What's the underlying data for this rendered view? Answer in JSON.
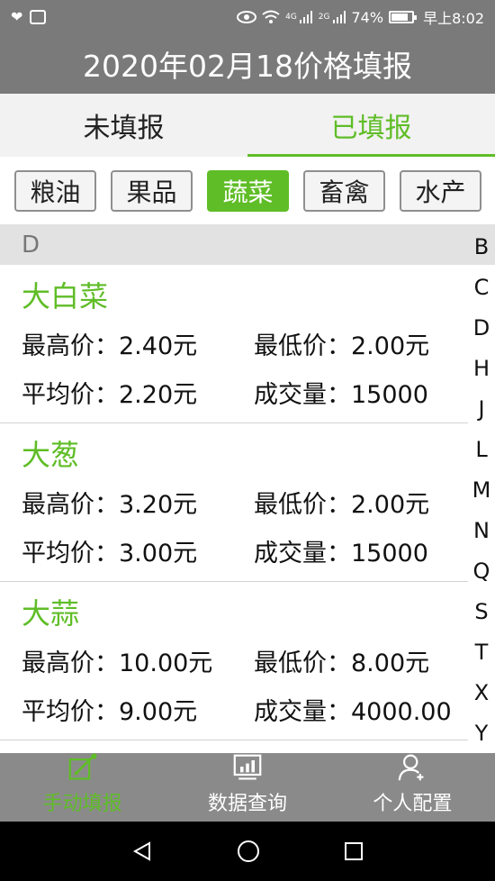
{
  "status_bar": {
    "battery_percent": "74%",
    "time": "早上8:02",
    "signal1": "4G",
    "signal2": "2G",
    "battery_level": 0.74,
    "icons": [
      "heart-monitor-icon",
      "app-icon",
      "eye-icon",
      "wifi-icon",
      "signal-icon",
      "signal-icon",
      "battery-icon"
    ]
  },
  "header": {
    "title": "2020年02月18价格填报"
  },
  "tabs": [
    {
      "label": "未填报",
      "active": false
    },
    {
      "label": "已填报",
      "active": true
    }
  ],
  "categories": [
    {
      "label": "粮油",
      "active": false
    },
    {
      "label": "果品",
      "active": false
    },
    {
      "label": "蔬菜",
      "active": true
    },
    {
      "label": "畜禽",
      "active": false
    },
    {
      "label": "水产",
      "active": false
    }
  ],
  "section_letter": "D",
  "items": [
    {
      "name": "大白菜",
      "max_label": "最高价：",
      "max": "2.40元",
      "min_label": "最低价：",
      "min": "2.00元",
      "avg_label": "平均价：",
      "avg": "2.20元",
      "vol_label": "成交量：",
      "vol": "15000"
    },
    {
      "name": "大葱",
      "max_label": "最高价：",
      "max": "3.20元",
      "min_label": "最低价：",
      "min": "2.00元",
      "avg_label": "平均价：",
      "avg": "3.00元",
      "vol_label": "成交量：",
      "vol": "15000"
    },
    {
      "name": "大蒜",
      "max_label": "最高价：",
      "max": "10.00元",
      "min_label": "最低价：",
      "min": "8.00元",
      "avg_label": "平均价：",
      "avg": "9.00元",
      "vol_label": "成交量：",
      "vol": "4000.00"
    }
  ],
  "alphabet_index": [
    "B",
    "C",
    "D",
    "H",
    "J",
    "L",
    "M",
    "N",
    "Q",
    "S",
    "T",
    "X",
    "Y"
  ],
  "bottom_nav": [
    {
      "label": "手动填报",
      "icon": "edit-icon",
      "active": true
    },
    {
      "label": "数据查询",
      "icon": "chart-icon",
      "active": false
    },
    {
      "label": "个人配置",
      "icon": "add-user-icon",
      "active": false
    }
  ],
  "colors": {
    "accent": "#5fbd27",
    "bar": "#7a7a7a",
    "nav": "#8a8a8a"
  }
}
